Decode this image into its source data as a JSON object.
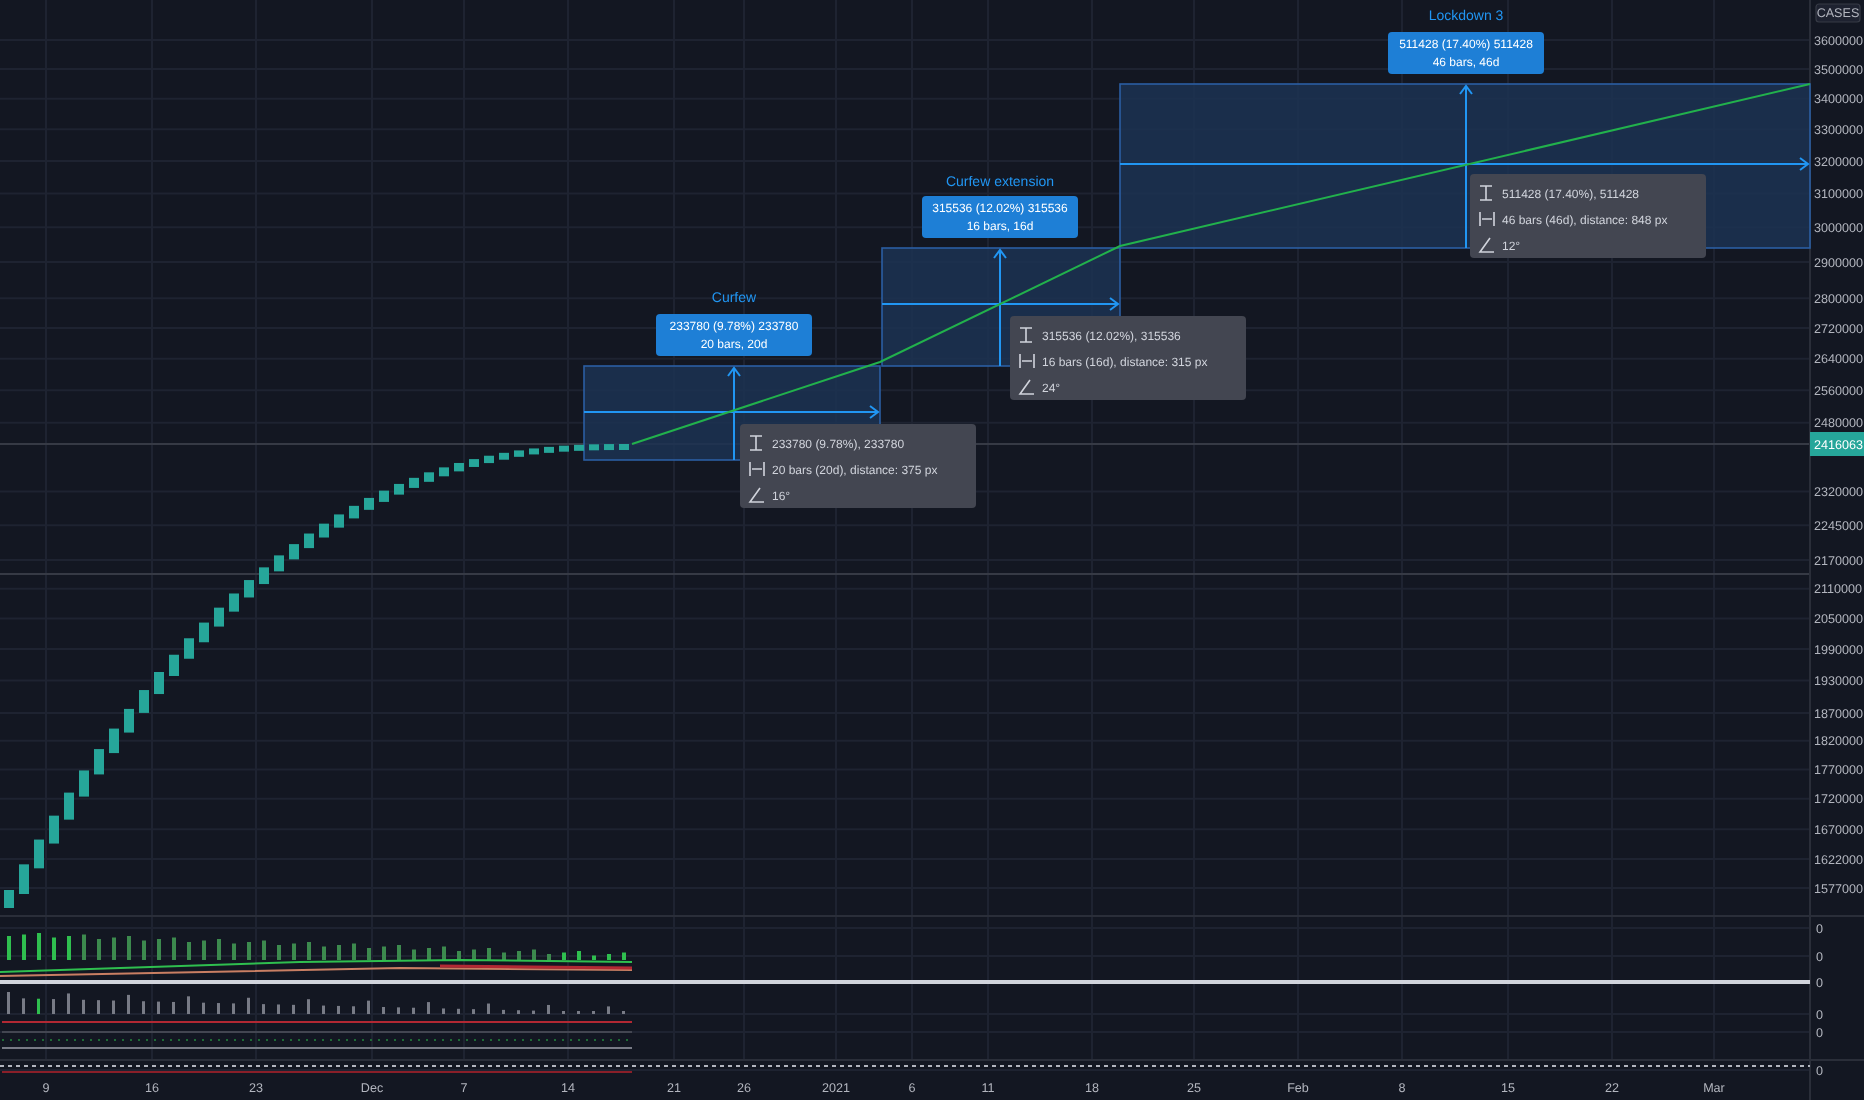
{
  "price_axis": {
    "unit_label": "CASES",
    "last_value": "2416063",
    "ticks": [
      "3600000",
      "3500000",
      "3400000",
      "3300000",
      "3200000",
      "3100000",
      "3000000",
      "2900000",
      "2800000",
      "2720000",
      "2640000",
      "2560000",
      "2480000",
      "2320000",
      "2245000",
      "2170000",
      "2110000",
      "2050000",
      "1990000",
      "1930000",
      "1870000",
      "1820000",
      "1770000",
      "1720000",
      "1670000",
      "1622000",
      "1577000"
    ]
  },
  "measurements": [
    {
      "title": "Curfew",
      "badge_lines": [
        "233780 (9.78%) 233780",
        "20 bars, 20d"
      ],
      "info": [
        {
          "kind": "price",
          "text": "233780 (9.78%), 233780"
        },
        {
          "kind": "range",
          "text": "20 bars (20d), distance: 375 px"
        },
        {
          "kind": "angle",
          "text": "16°"
        }
      ]
    },
    {
      "title": "Curfew extension",
      "badge_lines": [
        "315536 (12.02%) 315536",
        "16 bars, 16d"
      ],
      "info": [
        {
          "kind": "price",
          "text": "315536 (12.02%), 315536"
        },
        {
          "kind": "range",
          "text": "16 bars (16d), distance: 315 px"
        },
        {
          "kind": "angle",
          "text": "24°"
        }
      ]
    },
    {
      "title": "Lockdown 3",
      "badge_lines": [
        "511428 (17.40%) 511428",
        "46 bars, 46d"
      ],
      "info": [
        {
          "kind": "price",
          "text": "511428 (17.40%), 511428"
        },
        {
          "kind": "range",
          "text": "46 bars (46d), distance: 848 px"
        },
        {
          "kind": "angle",
          "text": "12°"
        }
      ]
    }
  ],
  "indicator_axis": {
    "ticks": [
      "0",
      "0",
      "0",
      "0",
      "0",
      "0"
    ]
  },
  "time_axis": {
    "ticks": [
      "9",
      "16",
      "23",
      "Dec",
      "7",
      "14",
      "21",
      "26",
      "2021",
      "6",
      "11",
      "18",
      "25",
      "Feb",
      "8",
      "15",
      "22",
      "Mar"
    ]
  }
}
